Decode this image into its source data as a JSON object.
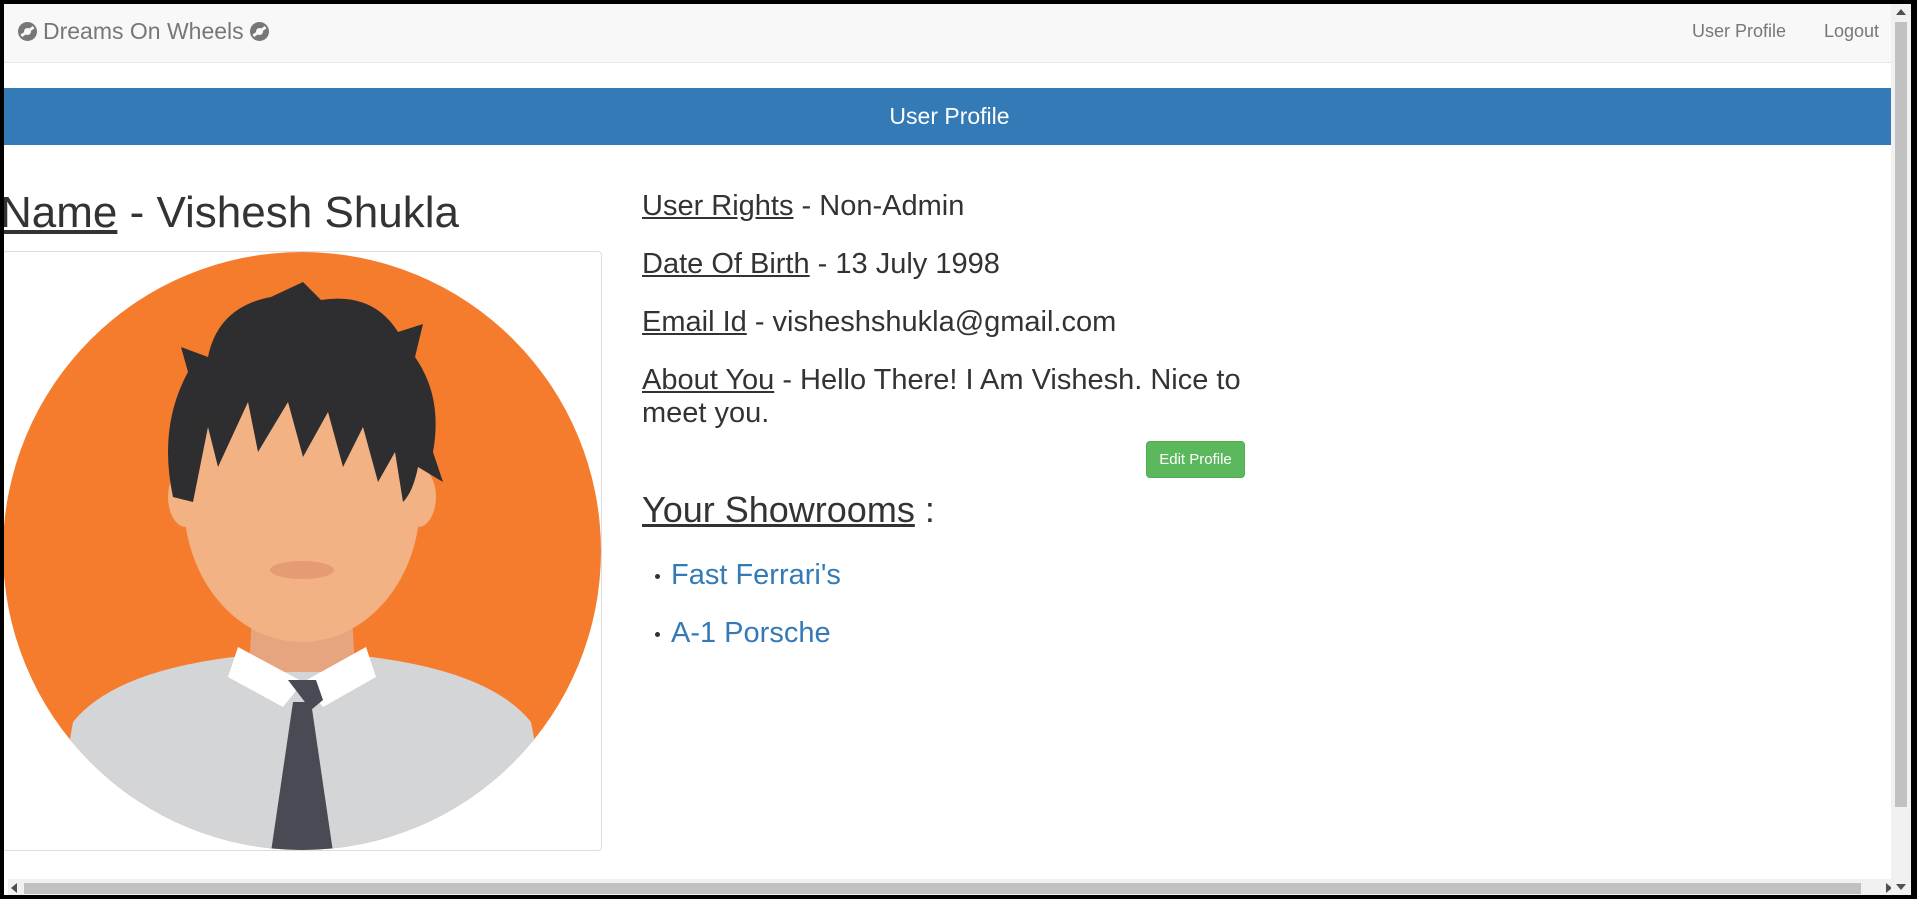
{
  "navbar": {
    "brand": "Dreams On Wheels",
    "links": [
      "User Profile",
      "Logout"
    ]
  },
  "panel": {
    "heading": "User Profile"
  },
  "profile": {
    "name_label": "Name",
    "name_value": " - Vishesh Shukla",
    "rights_label": "User Rights",
    "rights_value": " - Non-Admin",
    "dob_label": "Date Of Birth",
    "dob_value": " - 13 July 1998",
    "email_label": "Email Id",
    "email_value": " - visheshshukla@gmail.com",
    "about_label": "About You",
    "about_value": " - Hello There! I Am Vishesh. Nice to meet you.",
    "edit_button": "Edit Profile"
  },
  "showrooms": {
    "title": "Your Showrooms",
    "suffix": " :",
    "items": [
      "Fast Ferrari's",
      "A-1 Porsche"
    ]
  },
  "colors": {
    "primary": "#337ab7",
    "success": "#5cb85c",
    "avatar_bg": "#f47c2c"
  }
}
